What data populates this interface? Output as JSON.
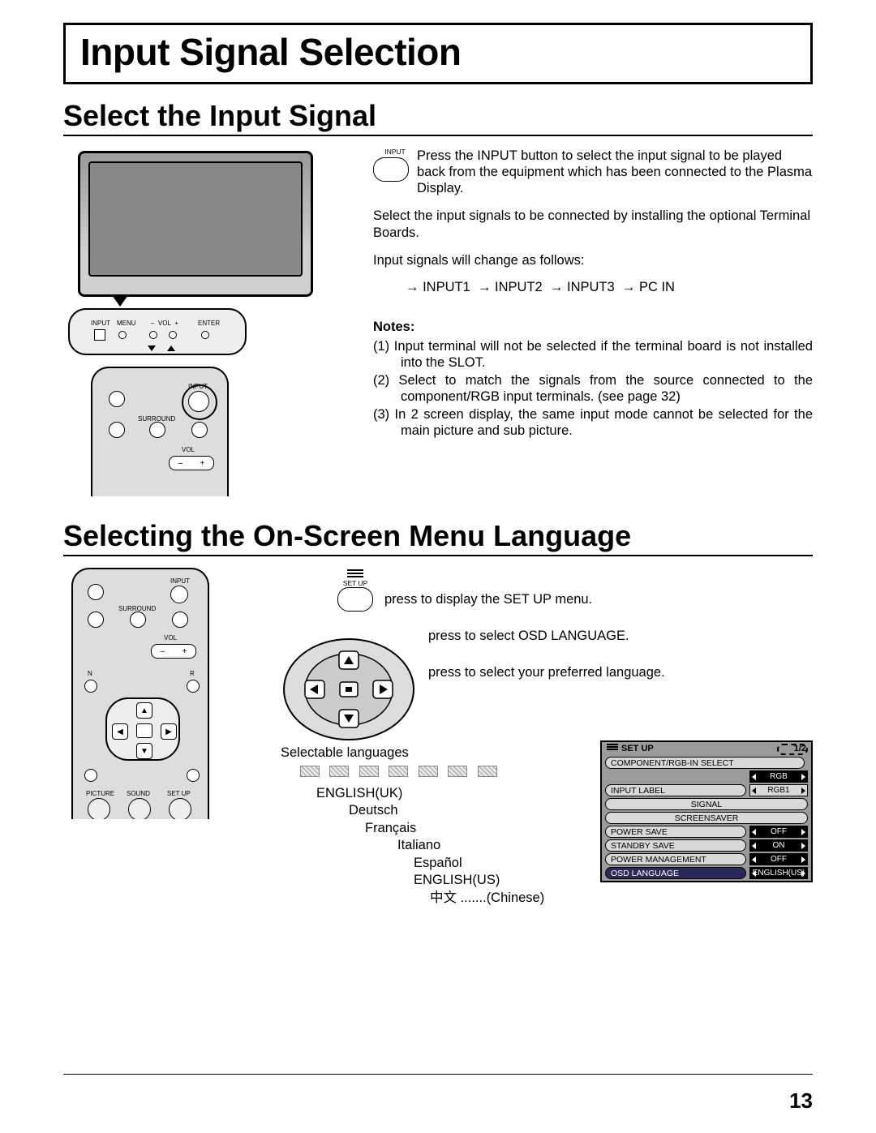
{
  "title": "Input Signal Selection",
  "section1": {
    "heading": "Select the Input Signal",
    "panel": {
      "input": "INPUT",
      "menu": "MENU",
      "vol": "VOL",
      "enter": "ENTER"
    },
    "remote": {
      "input": "INPUT",
      "surround": "SURROUND",
      "vol": "VOL"
    },
    "btn_label": "INPUT",
    "para1": "Press the INPUT button to select the input signal to be played back from the equipment which has been connected to the  Plasma Display.",
    "para2": "Select the input signals to be connected by installing the optional Terminal Boards.",
    "para3": "Input signals will change as follows:",
    "cycle": {
      "a": "INPUT1",
      "b": "INPUT2",
      "c": "INPUT3",
      "d": "PC IN"
    },
    "notes_h": "Notes:",
    "note1": "(1) Input terminal will not be selected if the terminal board is not installed into the SLOT.",
    "note2": "(2) Select to match the signals from the source connected to the component/RGB input terminals. (see page 32)",
    "note3": "(3) In 2 screen display, the same input mode cannot be selected for the main picture and sub picture."
  },
  "section2": {
    "heading": "Selecting the On-Screen Menu Language",
    "setup_label": "SET UP",
    "remote": {
      "input": "INPUT",
      "surround": "SURROUND",
      "vol": "VOL",
      "n": "N",
      "r": "R",
      "picture": "PICTURE",
      "sound": "SOUND",
      "setup": "SET UP"
    },
    "instr1": "press to display the SET UP menu.",
    "instr2": "press to select OSD LANGUAGE.",
    "instr3": "press to select your preferred language.",
    "sel_label": "Selectable languages",
    "langs": {
      "uk": "ENGLISH(UK)",
      "de": "Deutsch",
      "fr": "Français",
      "it": "Italiano",
      "es": "Español",
      "us": "ENGLISH(US)",
      "cn_native": "中文",
      "cn_dots": ".......",
      "cn_paren": "(Chinese)"
    }
  },
  "osd": {
    "title": "SET UP",
    "page": "1/2",
    "rows": {
      "comp": "COMPONENT/RGB-IN SELECT",
      "comp_val": "RGB",
      "input_label": "INPUT LABEL",
      "input_label_val": "RGB1",
      "signal": "SIGNAL",
      "screensaver": "SCREENSAVER",
      "power_save": "POWER SAVE",
      "power_save_val": "OFF",
      "standby_save": "STANDBY SAVE",
      "standby_save_val": "ON",
      "power_mgmt": "POWER MANAGEMENT",
      "power_mgmt_val": "OFF",
      "osd_lang": "OSD  LANGUAGE",
      "osd_lang_val": "ENGLISH(US)"
    }
  },
  "page_number": "13"
}
